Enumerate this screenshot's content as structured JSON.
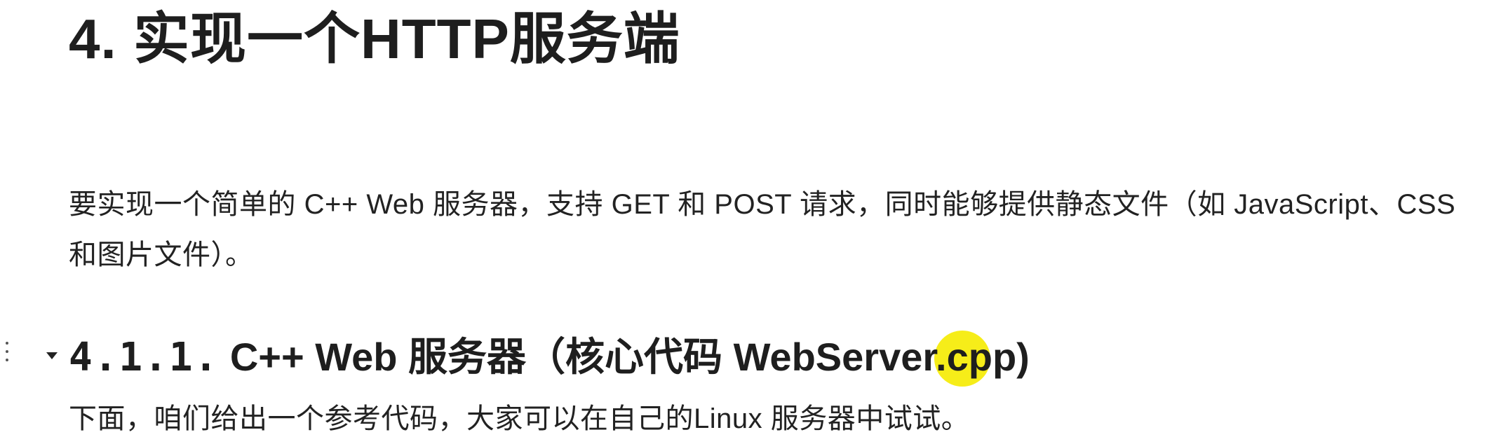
{
  "heading": {
    "title": "4. 实现一个HTTP服务端"
  },
  "paragraphs": {
    "intro": "要实现一个简单的 C++ Web 服务器，支持 GET 和 POST 请求，同时能够提供静态文件（如 JavaScript、CSS 和图片文件）。",
    "reference": "下面，咱们给出一个参考代码，大家可以在自己的Linux 服务器中试试。"
  },
  "subheading": {
    "number": "4.1.1.",
    "title": "C++ Web 服务器（核心代码 WebServer.cpp)"
  },
  "icons": {
    "drag_handle": "drag-handle-icon",
    "collapse": "caret-down-icon"
  },
  "colors": {
    "text": "#1f1f1f",
    "cursor_highlight": "#f5eb00"
  }
}
